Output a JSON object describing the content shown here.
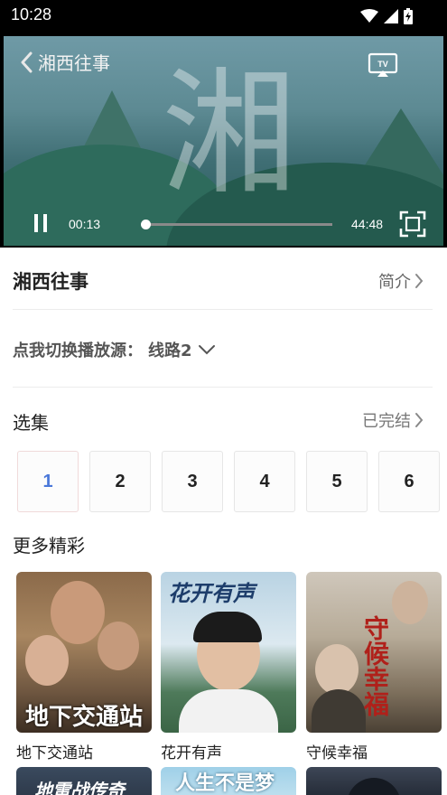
{
  "status_bar": {
    "time": "10:28"
  },
  "player": {
    "title": "湘西往事",
    "current_time": "00:13",
    "total_time": "44:48",
    "progress_fraction": 0.005,
    "overlay_char": "湘",
    "tv_label": "TV"
  },
  "info": {
    "title": "湘西往事",
    "intro_label": "简介"
  },
  "source": {
    "label": "点我切换播放源：",
    "value": "线路2"
  },
  "episodes": {
    "title": "选集",
    "status": "已完结",
    "items": [
      "1",
      "2",
      "3",
      "4",
      "5",
      "6"
    ],
    "active_index": 0
  },
  "more": {
    "title": "更多精彩",
    "cards": [
      {
        "label": "地下交通站",
        "poster_text": "地下交通站"
      },
      {
        "label": "花开有声",
        "poster_text": "花开有声"
      },
      {
        "label": "守候幸福",
        "poster_text": "守候幸福"
      }
    ],
    "row2_poster_text": [
      "地雷战传奇",
      "人生不是梦",
      ""
    ]
  },
  "colors": {
    "accent": "#4a78d9",
    "player_bg": "#000000"
  }
}
